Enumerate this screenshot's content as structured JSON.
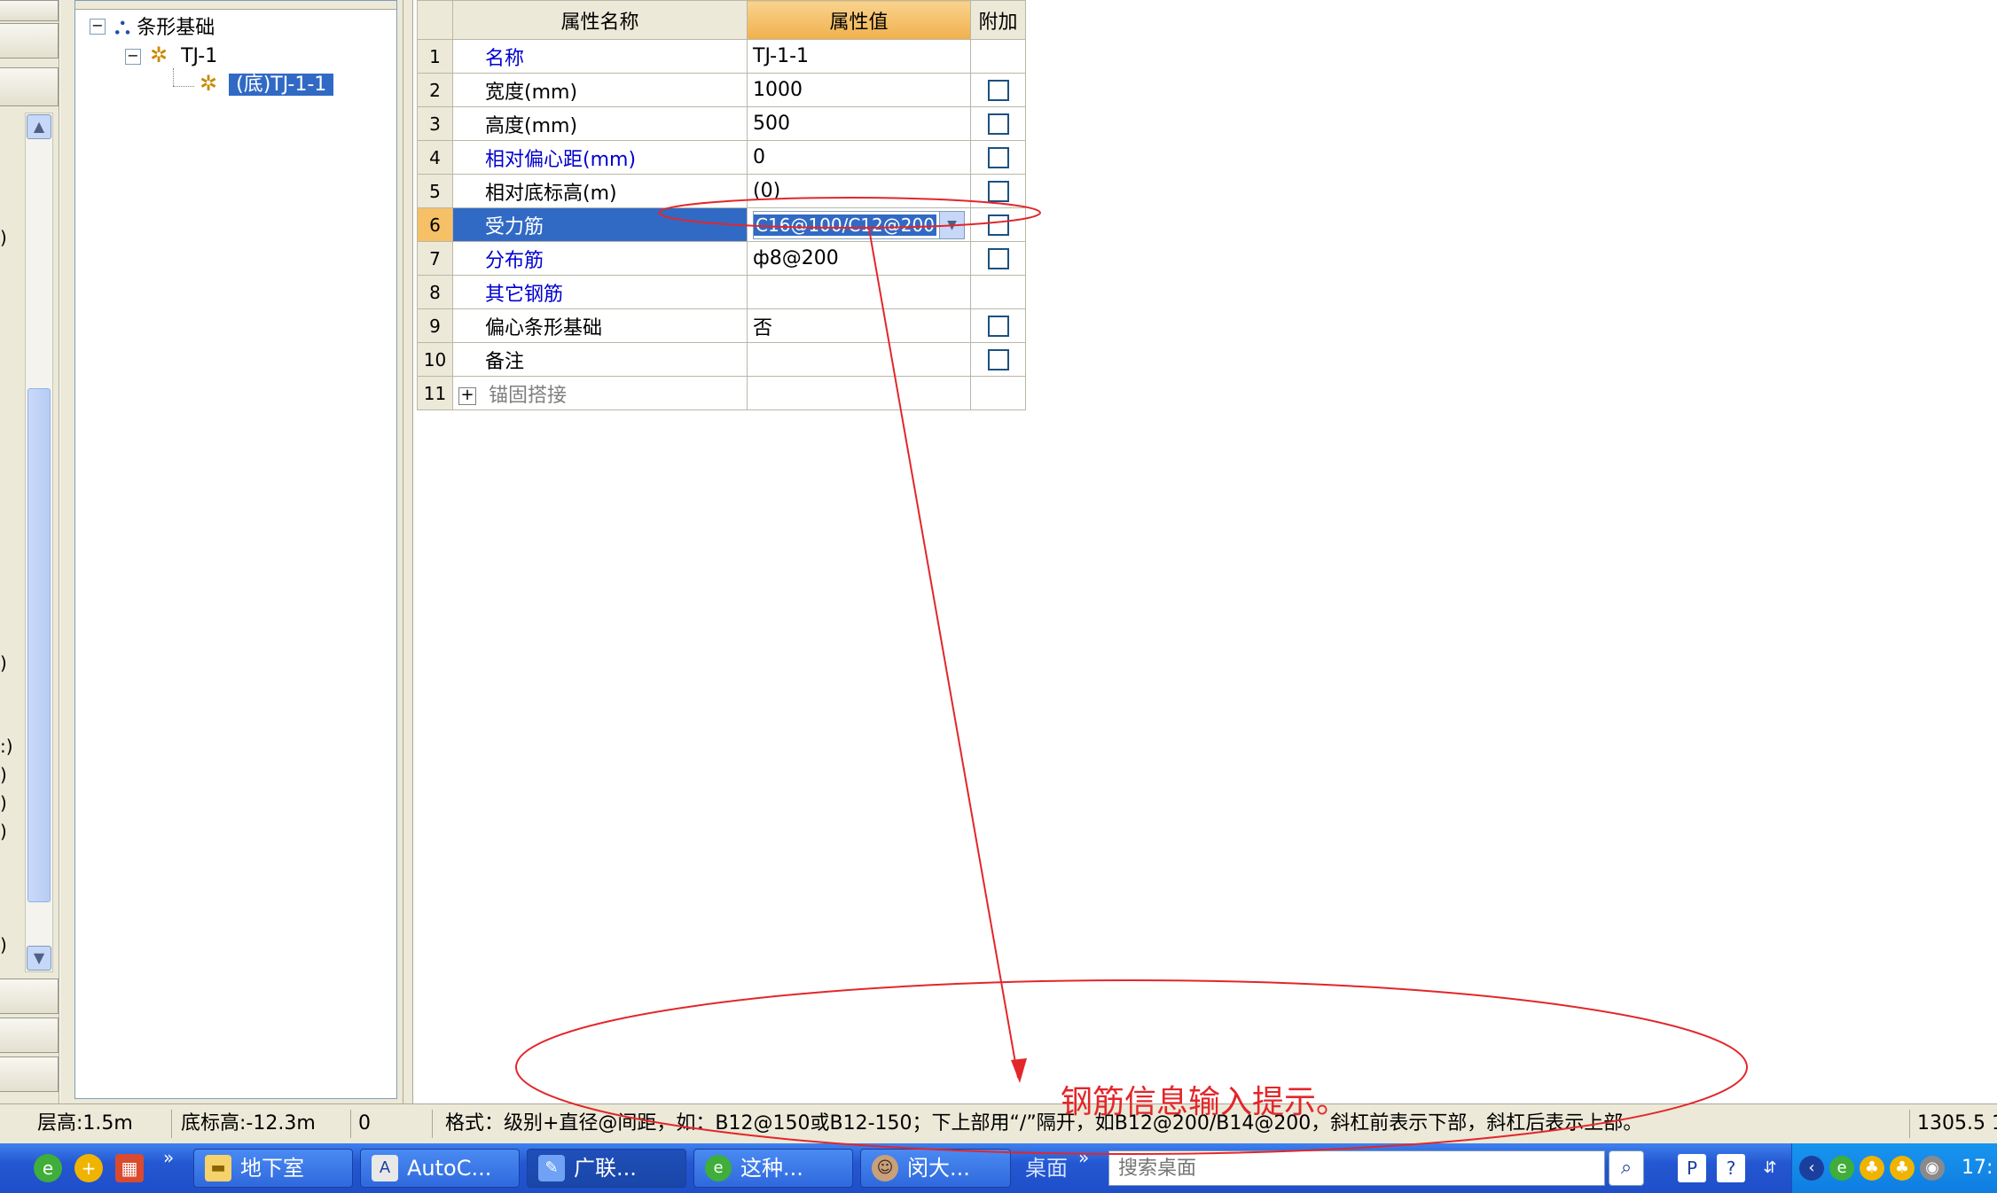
{
  "left_strip": {
    "fragments": [
      ")",
      ")",
      ":)",
      ")",
      ")",
      ")",
      ")"
    ]
  },
  "tree": {
    "root_label": "条形基础",
    "child_label": "TJ-1",
    "leaf_label": "(底)TJ-1-1"
  },
  "grid": {
    "headers": {
      "name": "属性名称",
      "value": "属性值",
      "extra": "附加"
    },
    "rows": [
      {
        "num": "1",
        "name": "名称",
        "value": "TJ-1-1"
      },
      {
        "num": "2",
        "name": "宽度(mm)",
        "value": "1000"
      },
      {
        "num": "3",
        "name": "高度(mm)",
        "value": "500"
      },
      {
        "num": "4",
        "name": "相对偏心距(mm)",
        "value": "0"
      },
      {
        "num": "5",
        "name": "相对底标高(m)",
        "value": "(0)"
      },
      {
        "num": "6",
        "name": "受力筋",
        "value": "C16@100/C12@200"
      },
      {
        "num": "7",
        "name": "分布筋",
        "value": "ф8@200"
      },
      {
        "num": "8",
        "name": "其它钢筋",
        "value": ""
      },
      {
        "num": "9",
        "name": "偏心条形基础",
        "value": "否"
      },
      {
        "num": "10",
        "name": "备注",
        "value": ""
      },
      {
        "num": "11",
        "name": "锚固搭接",
        "value": ""
      }
    ]
  },
  "status_bar": {
    "floor_height": "层高:1.5m",
    "bottom_elevation": "底标高:-12.3m",
    "zero": "0",
    "hint": "格式：级别+直径@间距，如：B12@150或B12-150；下上部用“/”隔开，如B12@200/B14@200，斜杠前表示下部，斜杠后表示上部。",
    "coord": "1305.5 1"
  },
  "annotation": {
    "text": "钢筋信息输入提示。",
    "color": "#e3262a"
  },
  "taskbar": {
    "items": [
      "地下室",
      "AutoC...",
      "广联...",
      "这种...",
      "闵大..."
    ],
    "desktop_label": "桌面",
    "search_placeholder": "搜索桌面",
    "clock": "17:"
  }
}
